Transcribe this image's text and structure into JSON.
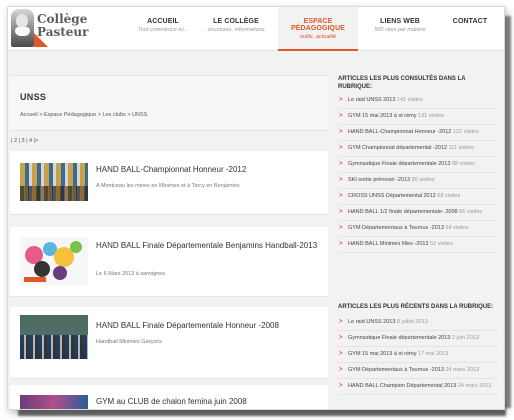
{
  "logo": {
    "line1": "Collège",
    "line2": "Pasteur"
  },
  "nav": [
    {
      "label": "ACCUEIL",
      "sub": "Tout commence ici..."
    },
    {
      "label": "LE COLLÈGE",
      "sub": "structures, informations"
    },
    {
      "label": "ESPACE PÉDAGOGIQUE",
      "sub": "outils, actualité"
    },
    {
      "label": "LIENS WEB",
      "sub": "500 sites par matière"
    },
    {
      "label": "CONTACT",
      "sub": ""
    }
  ],
  "page": {
    "title": "UNSS",
    "breadcrumb": "Accueil > Espace Pédagogique > Les clubs > UNSS",
    "pager": "| 2 | 3 | 4 |>"
  },
  "articles": [
    {
      "title": "HAND BALL-Championnat Honneur -2012",
      "subtitle": "A Montceau les mines en Minimes et à Torcy en Benjamins"
    },
    {
      "title": "HAND BALL Finale Départementale Benjamins Handball-2013",
      "subtitle": "Le 6 Mars 2013 à sanvignes"
    },
    {
      "title": "HAND BALL Finale Départementale Honneur -2008",
      "subtitle": "Handball Minimes Garçons"
    },
    {
      "title": "GYM au CLUB de chalon femina juin 2008",
      "subtitle": ""
    }
  ],
  "sidebar": {
    "most_read_title": "ARTICLES LES PLUS CONSULTÉS DANS LA RUBRIQUE:",
    "most_read": [
      {
        "label": "Le raid UNSS 2013",
        "meta": "141 visites"
      },
      {
        "label": "GYM 15 mai 2013 à st rémy",
        "meta": "131 visites"
      },
      {
        "label": "HAND BALL-Championnat Honneur -2012",
        "meta": "122 visites"
      },
      {
        "label": "GYM Championnat départemental -2012",
        "meta": "111 visites"
      },
      {
        "label": "Gymnastique Finale départementale 2013",
        "meta": "88 visites"
      },
      {
        "label": "SKI sortie prénovel -2013",
        "meta": "80 visites"
      },
      {
        "label": "CROSS UNSS Départemental 2012",
        "meta": "68 visites"
      },
      {
        "label": "HAND BALL 1/2 finale départementale- 2008",
        "meta": "66 visites"
      },
      {
        "label": "GYM Départementaux à Tournus -2013",
        "meta": "64 visites"
      },
      {
        "label": "HAND BALL Minimes filles -2013",
        "meta": "52 visites"
      }
    ],
    "recent_title": "ARTICLES LES PLUS RÉCENTS DANS LA RUBRIQUE:",
    "recent": [
      {
        "label": "Le raid UNSS 2013",
        "meta": "8 juillet 2013"
      },
      {
        "label": "Gymnastique Finale départementale 2013",
        "meta": "2 juin 2013"
      },
      {
        "label": "GYM 15 mai 2013 à st rémy",
        "meta": "17 mai 2013"
      },
      {
        "label": "GYM Départementaux à Tournus -2013",
        "meta": "24 mars 2013"
      },
      {
        "label": "HAND BALL Champion Départemental 2013",
        "meta": "24 mars 2013"
      }
    ]
  },
  "colors": {
    "accent": "#e0572a",
    "frame": "#f2f2f2"
  }
}
